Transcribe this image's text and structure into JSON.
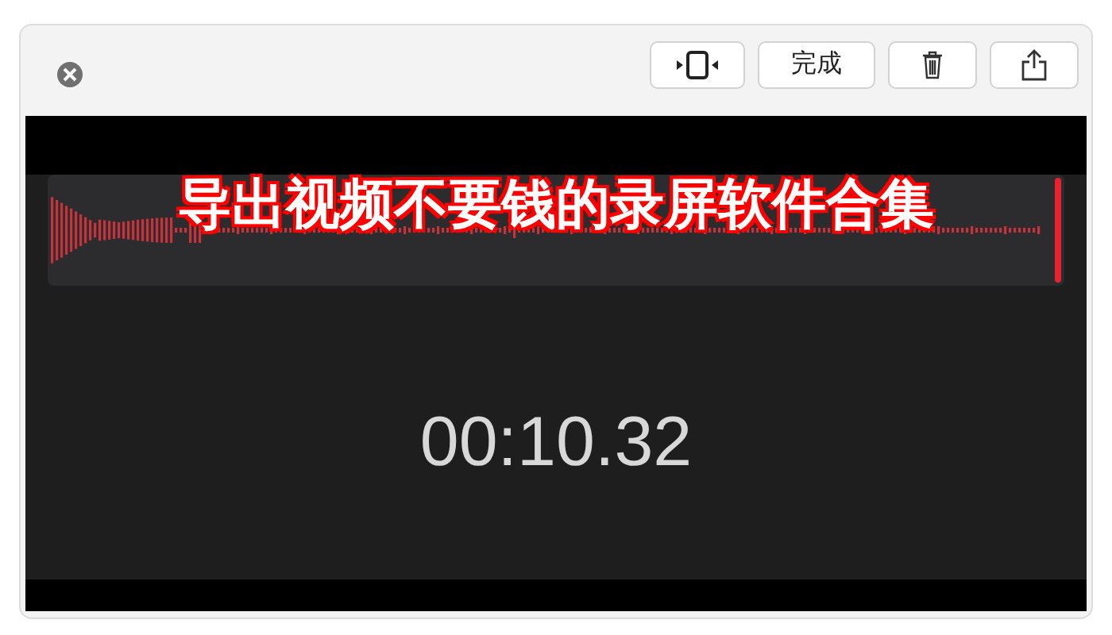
{
  "caption": "导出视频不要钱的录屏软件合集",
  "toolbar": {
    "done_button": "完成"
  },
  "recording": {
    "elapsed": "00:10.32"
  }
}
